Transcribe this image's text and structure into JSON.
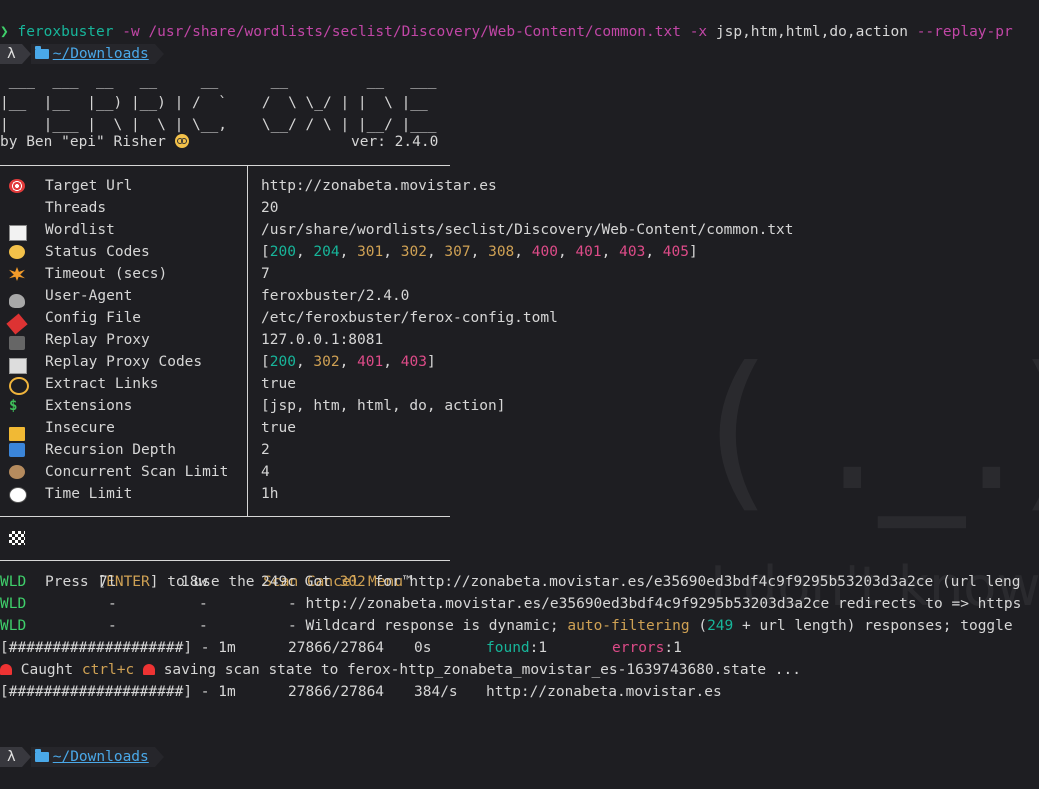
{
  "prompt": {
    "symbol": "λ",
    "path": "~/Downloads"
  },
  "command": {
    "marker": "❯",
    "program": "feroxbuster",
    "flag_w": "-w",
    "wordlist_path": "/usr/share/wordlists/seclist/Discovery/Web-Content/common.txt",
    "flag_x": "-x",
    "extensions": "jsp,htm,html,do,action",
    "flag_replay": "--replay-pr"
  },
  "banner": {
    "art_lines": [
      " ___  ___  __   __     __      __         __   ___",
      "|__  |__  |__) |__) | /  `    /  \\ \\_/ | |  \\ |__",
      "|    |___ |  \\ |  \\ | \\__,    \\__/ / \\ | |__/ |___"
    ],
    "author_prefix": "by Ben \"epi\" Risher ",
    "version": "ver: 2.4.0"
  },
  "config": [
    {
      "icon": "target-icon",
      "key": "Target Url",
      "value": "http://zonabeta.movistar.es"
    },
    {
      "icon": "rocket-icon",
      "key": "Threads",
      "value": "20"
    },
    {
      "icon": "book-icon",
      "key": "Wordlist",
      "value": "/usr/share/wordlists/seclist/Discovery/Web-Content/common.txt"
    },
    {
      "icon": "ok-hand-icon",
      "key": "Status Codes",
      "codes": [
        "200",
        "204",
        "301",
        "302",
        "307",
        "308",
        "400",
        "401",
        "403",
        "405"
      ]
    },
    {
      "icon": "collision-icon",
      "key": "Timeout (secs)",
      "value": "7"
    },
    {
      "icon": "rat-icon",
      "key": "User-Agent",
      "value": "feroxbuster/2.4.0"
    },
    {
      "icon": "syringe-icon",
      "key": "Config File",
      "value": "/etc/feroxbuster/ferox-config.toml"
    },
    {
      "icon": "camera-icon",
      "key": "Replay Proxy",
      "value": "127.0.0.1:8081"
    },
    {
      "icon": "cassette-icon",
      "key": "Replay Proxy Codes",
      "codes": [
        "200",
        "302",
        "401",
        "403"
      ]
    },
    {
      "icon": "magnifier-icon",
      "key": "Extract Links",
      "value": "true"
    },
    {
      "icon": "dollar-icon",
      "key": "Extensions",
      "value": "[jsp, htm, html, do, action]"
    },
    {
      "icon": "lock-icon",
      "key": "Insecure",
      "value": "true"
    },
    {
      "icon": "repeat-icon",
      "key": "Recursion Depth",
      "value": "2"
    },
    {
      "icon": "sloth-icon",
      "key": "Concurrent Scan Limit",
      "value": "4"
    },
    {
      "icon": "clock-icon",
      "key": "Time Limit",
      "value": "1h"
    }
  ],
  "code_colors": {
    "200": "#17b59a",
    "204": "#17b59a",
    "301": "#cfa154",
    "302": "#cfa154",
    "307": "#cfa154",
    "308": "#cfa154",
    "400": "#dd4b88",
    "401": "#dd4b88",
    "403": "#dd4b88",
    "405": "#dd4b88"
  },
  "cancel_menu": {
    "prefix": "Press [",
    "key": "ENTER",
    "middle": "] to use the ",
    "menu": "Scan Cancel Menu",
    "suffix": "™"
  },
  "results": [
    {
      "tag": "WLD",
      "lines": "7l",
      "words": "18w",
      "chars": "249c",
      "text_a": "Got ",
      "code": "302",
      "text_b": " for http://zonabeta.movistar.es/e35690ed3bdf4c9f9295b53203d3a2ce (url leng"
    },
    {
      "tag": "WLD",
      "lines": "-",
      "words": "-",
      "chars": "-",
      "text_a": "http://zonabeta.movistar.es/e35690ed3bdf4c9f9295b53203d3a2ce redirects to => https"
    },
    {
      "tag": "WLD",
      "lines": "-",
      "words": "-",
      "chars": "-",
      "text_a": "Wildcard response is dynamic; ",
      "hl": "auto-filtering",
      "text_b": " (",
      "num": "249",
      "text_c": " + url length) responses; toggle"
    }
  ],
  "progress1": {
    "bar": "[####################]",
    "time": "- 1m",
    "count": "27866/27864",
    "rate": "0s",
    "found_label": "found",
    "found_val": ":1",
    "errors_label": "errors",
    "errors_val": ":1"
  },
  "caught": {
    "text_a": " Caught ",
    "keys": "ctrl+c",
    "text_b": " saving scan state to ferox-http_zonabeta_movistar_es-1639743680.state ..."
  },
  "progress2": {
    "bar": "[####################]",
    "time": "- 1m",
    "count": "27866/27864",
    "rate": "384/s",
    "url": "http://zonabeta.movistar.es"
  },
  "prompt2": {
    "symbol": "λ",
    "path": "~/Downloads"
  }
}
